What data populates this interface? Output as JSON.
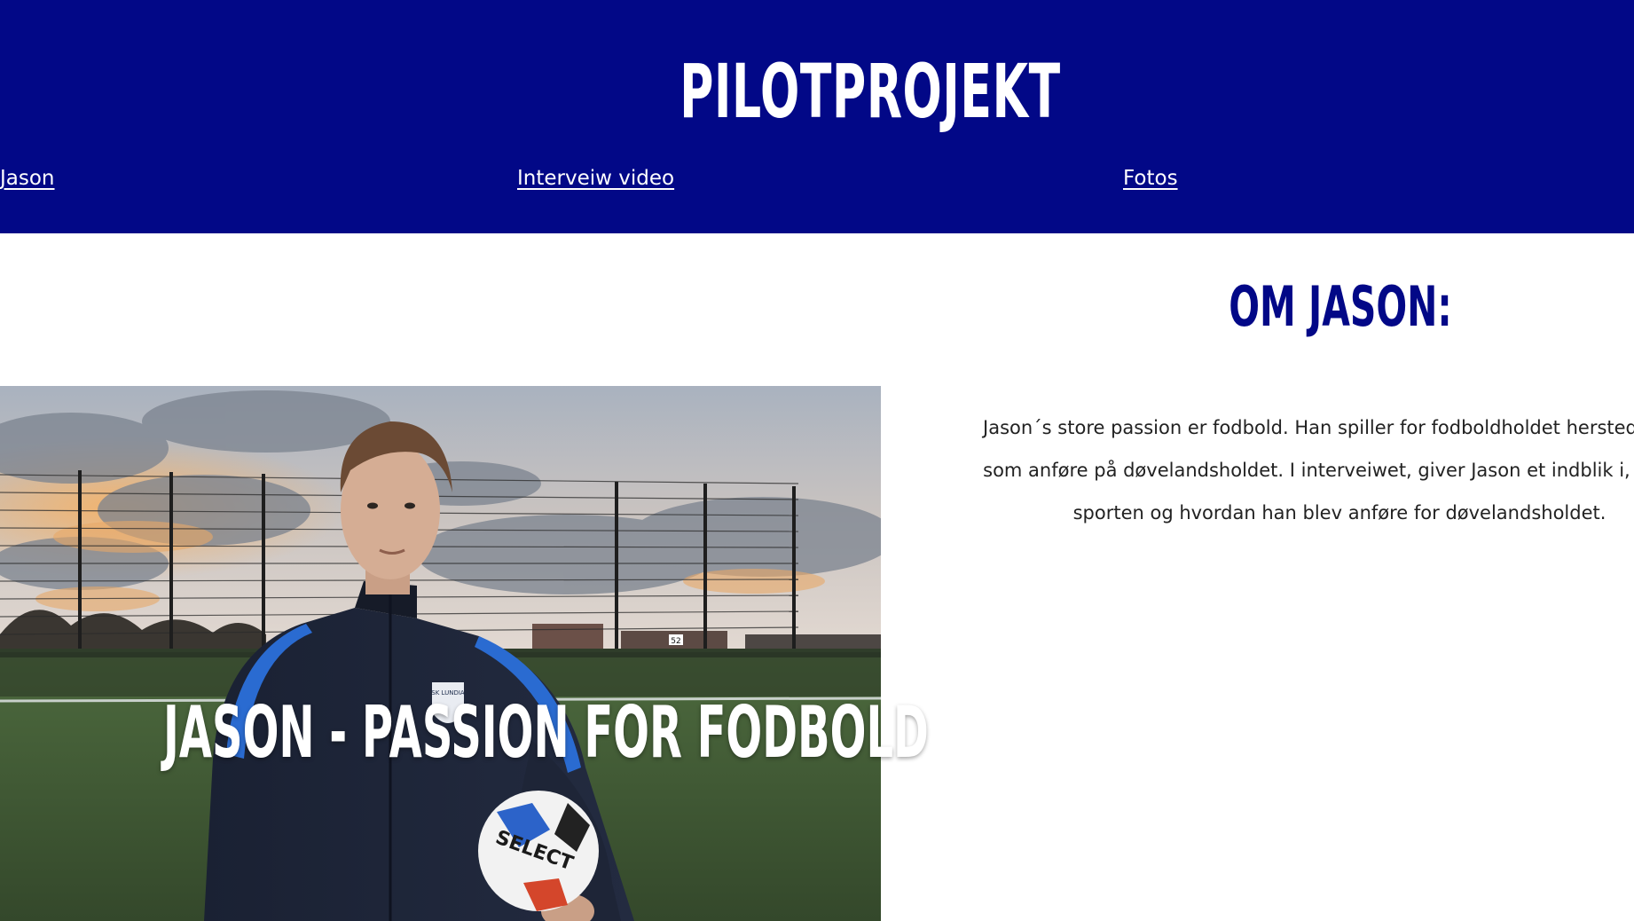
{
  "header": {
    "title": "PILOTPROJEKT",
    "background_color": "#020887",
    "nav": [
      {
        "label": "Jason"
      },
      {
        "label": "Interveiw video"
      },
      {
        "label": "Fotos"
      }
    ]
  },
  "hero": {
    "caption": "JASON - PASSION FOR FODBOLD",
    "jacket_badge": "SK LUNDIA",
    "ball_text": "SELECT",
    "fence_number": "52"
  },
  "about": {
    "heading": "OM JASON:",
    "heading_color": "#020887",
    "lines": [
      "Jason´s store passion er fodbold. Han spiller for fodboldholdet herstedøster i",
      "som anføre på døvelandsholdet. I interveiwet, giver Jason et indblik i, hvorfo",
      "sporten og hvordan han blev anføre for døvelandsholdet."
    ]
  }
}
